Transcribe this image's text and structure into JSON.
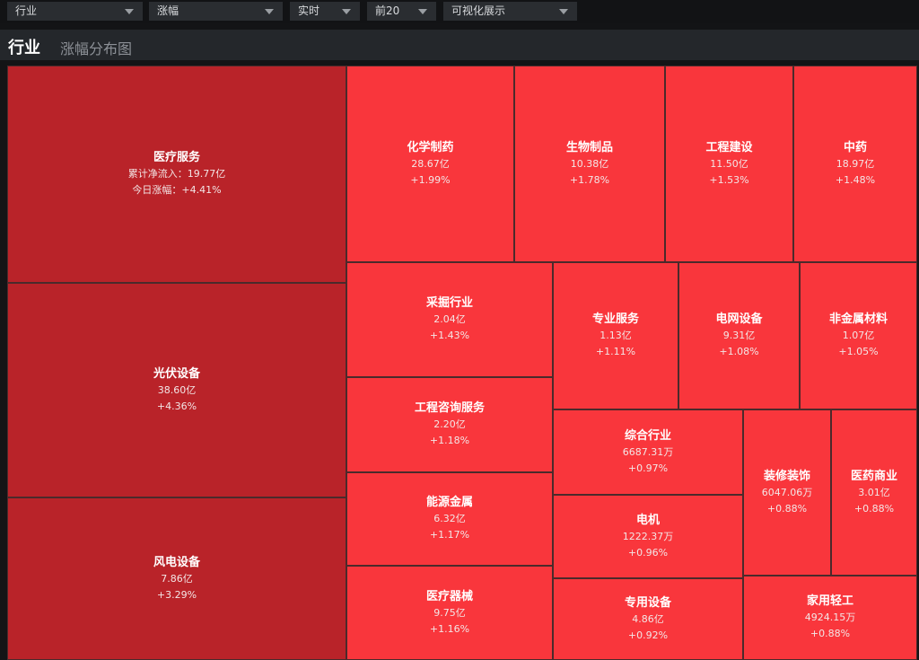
{
  "toolbar": {
    "selects": [
      {
        "value": "行业"
      },
      {
        "value": "涨幅"
      },
      {
        "value": "实时"
      },
      {
        "value": "前20"
      },
      {
        "value": "可视化展示"
      }
    ]
  },
  "header": {
    "title": "行业",
    "subtitle": "涨幅分布图"
  },
  "colors": {
    "strong": "#b92329",
    "normal": "#f9363c"
  },
  "chart_data": {
    "type": "treemap",
    "title": "涨幅分布图",
    "size_metric": "累计净流入",
    "color_metric": "今日涨幅",
    "items": [
      {
        "name": "医疗服务",
        "inflow": "累计净流入：19.77亿",
        "change": "今日涨幅：+4.41%",
        "inflow_value": 19.77,
        "change_pct": 4.41
      },
      {
        "name": "光伏设备",
        "inflow": "38.60亿",
        "change": "+4.36%",
        "inflow_value": 38.6,
        "change_pct": 4.36
      },
      {
        "name": "风电设备",
        "inflow": "7.86亿",
        "change": "+3.29%",
        "inflow_value": 7.86,
        "change_pct": 3.29
      },
      {
        "name": "化学制药",
        "inflow": "28.67亿",
        "change": "+1.99%",
        "inflow_value": 28.67,
        "change_pct": 1.99
      },
      {
        "name": "生物制品",
        "inflow": "10.38亿",
        "change": "+1.78%",
        "inflow_value": 10.38,
        "change_pct": 1.78
      },
      {
        "name": "工程建设",
        "inflow": "11.50亿",
        "change": "+1.53%",
        "inflow_value": 11.5,
        "change_pct": 1.53
      },
      {
        "name": "中药",
        "inflow": "18.97亿",
        "change": "+1.48%",
        "inflow_value": 18.97,
        "change_pct": 1.48
      },
      {
        "name": "采掘行业",
        "inflow": "2.04亿",
        "change": "+1.43%",
        "inflow_value": 2.04,
        "change_pct": 1.43
      },
      {
        "name": "专业服务",
        "inflow": "1.13亿",
        "change": "+1.11%",
        "inflow_value": 1.13,
        "change_pct": 1.11
      },
      {
        "name": "电网设备",
        "inflow": "9.31亿",
        "change": "+1.08%",
        "inflow_value": 9.31,
        "change_pct": 1.08
      },
      {
        "name": "非金属材料",
        "inflow": "1.07亿",
        "change": "+1.05%",
        "inflow_value": 1.07,
        "change_pct": 1.05
      },
      {
        "name": "工程咨询服务",
        "inflow": "2.20亿",
        "change": "+1.18%",
        "inflow_value": 2.2,
        "change_pct": 1.18
      },
      {
        "name": "综合行业",
        "inflow": "6687.31万",
        "change": "+0.97%",
        "inflow_value": 0.6687,
        "change_pct": 0.97
      },
      {
        "name": "装修装饰",
        "inflow": "6047.06万",
        "change": "+0.88%",
        "inflow_value": 0.6047,
        "change_pct": 0.88
      },
      {
        "name": "医药商业",
        "inflow": "3.01亿",
        "change": "+0.88%",
        "inflow_value": 3.01,
        "change_pct": 0.88
      },
      {
        "name": "能源金属",
        "inflow": "6.32亿",
        "change": "+1.17%",
        "inflow_value": 6.32,
        "change_pct": 1.17
      },
      {
        "name": "电机",
        "inflow": "1222.37万",
        "change": "+0.96%",
        "inflow_value": 0.1222,
        "change_pct": 0.96
      },
      {
        "name": "医疗器械",
        "inflow": "9.75亿",
        "change": "+1.16%",
        "inflow_value": 9.75,
        "change_pct": 1.16
      },
      {
        "name": "专用设备",
        "inflow": "4.86亿",
        "change": "+0.92%",
        "inflow_value": 4.86,
        "change_pct": 0.92
      },
      {
        "name": "家用轻工",
        "inflow": "4924.15万",
        "change": "+0.88%",
        "inflow_value": 0.4924,
        "change_pct": 0.88
      }
    ]
  }
}
